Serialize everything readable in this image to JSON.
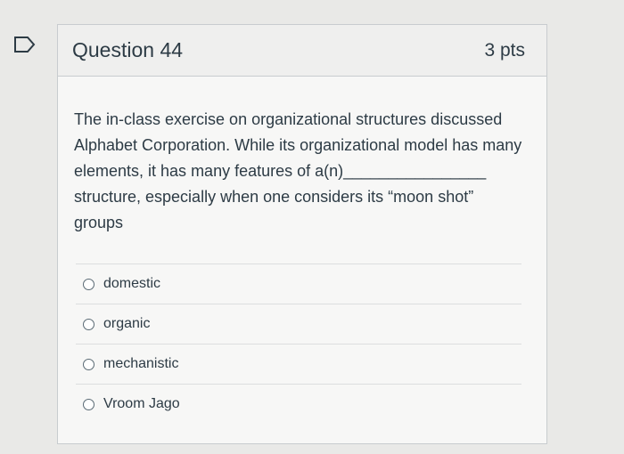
{
  "header": {
    "title": "Question 44",
    "points": "3 pts"
  },
  "question": {
    "text": "The in-class exercise on organizational structures discussed Alphabet Corporation. While its organizational model has many elements, it has many features of a(n)________________ structure, especially when one considers its “moon shot” groups"
  },
  "answers": [
    {
      "label": "domestic"
    },
    {
      "label": "organic"
    },
    {
      "label": "mechanistic"
    },
    {
      "label": "Vroom Jago"
    }
  ],
  "colors": {
    "background": "#e9e9e7",
    "card": "#f7f7f6",
    "border": "#c8cccf",
    "text": "#2d3b45"
  }
}
